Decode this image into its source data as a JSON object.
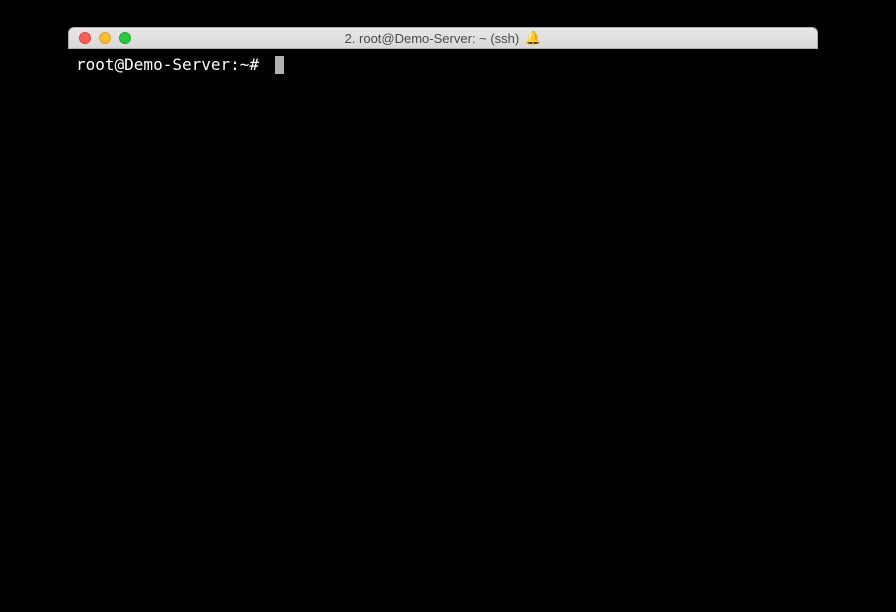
{
  "window": {
    "title": "2. root@Demo-Server: ~ (ssh)",
    "bell_icon": "🔔"
  },
  "terminal": {
    "prompt": "root@Demo-Server:~# "
  }
}
